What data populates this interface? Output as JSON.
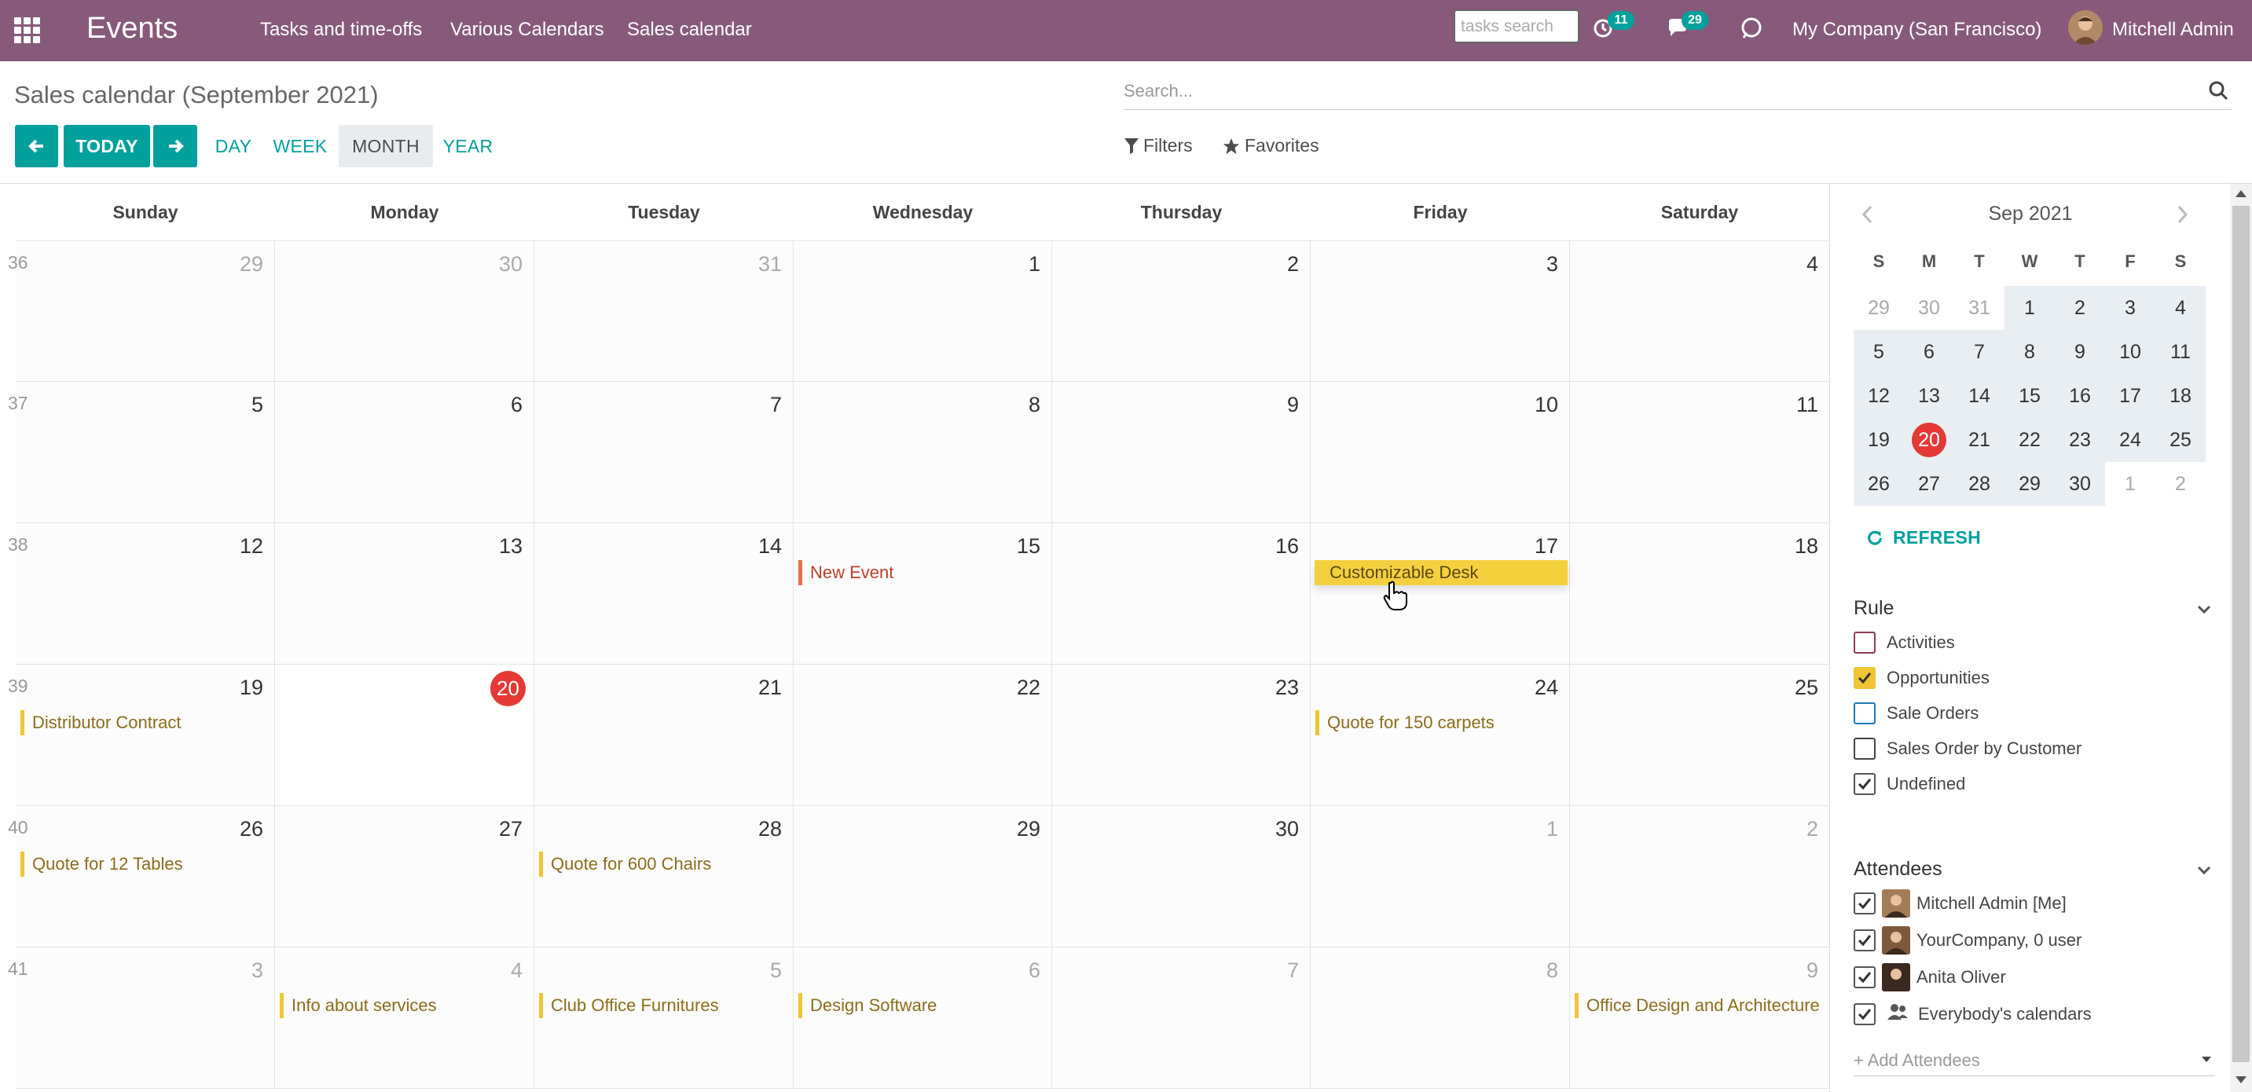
{
  "navbar": {
    "app_title": "Events",
    "menus": [
      "Tasks and time-offs",
      "Various Calendars",
      "Sales calendar"
    ],
    "tasks_search_placeholder": "tasks search",
    "activity_badge": "11",
    "messages_badge": "29",
    "company": "My Company (San Francisco)",
    "user": "Mitchell Admin"
  },
  "control_panel": {
    "breadcrumb": "Sales calendar (September 2021)",
    "search_placeholder": "Search...",
    "today_label": "TODAY",
    "scales": [
      "DAY",
      "WEEK",
      "MONTH",
      "YEAR"
    ],
    "active_scale": "MONTH",
    "filters_label": "Filters",
    "favorites_label": "Favorites"
  },
  "calendar": {
    "day_names": [
      "Sunday",
      "Monday",
      "Tuesday",
      "Wednesday",
      "Thursday",
      "Friday",
      "Saturday"
    ],
    "weeks": [
      {
        "num": "36",
        "days": [
          "29",
          "30",
          "31",
          "1",
          "2",
          "3",
          "4"
        ],
        "other": [
          true,
          true,
          true,
          false,
          false,
          false,
          false
        ]
      },
      {
        "num": "37",
        "days": [
          "5",
          "6",
          "7",
          "8",
          "9",
          "10",
          "11"
        ],
        "other": [
          false,
          false,
          false,
          false,
          false,
          false,
          false
        ]
      },
      {
        "num": "38",
        "days": [
          "12",
          "13",
          "14",
          "15",
          "16",
          "17",
          "18"
        ],
        "other": [
          false,
          false,
          false,
          false,
          false,
          false,
          false
        ]
      },
      {
        "num": "39",
        "days": [
          "19",
          "20",
          "21",
          "22",
          "23",
          "24",
          "25"
        ],
        "other": [
          false,
          false,
          false,
          false,
          false,
          false,
          false
        ]
      },
      {
        "num": "40",
        "days": [
          "26",
          "27",
          "28",
          "29",
          "30",
          "1",
          "2"
        ],
        "other": [
          false,
          false,
          false,
          false,
          false,
          true,
          true
        ]
      },
      {
        "num": "41",
        "days": [
          "3",
          "4",
          "5",
          "6",
          "7",
          "8",
          "9"
        ],
        "other": [
          true,
          true,
          true,
          true,
          true,
          true,
          true
        ]
      }
    ],
    "today": "20",
    "events": [
      {
        "title": "New Event",
        "week": 2,
        "day": 3,
        "style": "red"
      },
      {
        "title": "Customizable Desk",
        "week": 2,
        "day": 5,
        "style": "highlight"
      },
      {
        "title": "Distributor Contract",
        "week": 3,
        "day": 0,
        "style": "yellow"
      },
      {
        "title": "Quote for 150 carpets",
        "week": 3,
        "day": 5,
        "style": "yellow"
      },
      {
        "title": "Quote for 12 Tables",
        "week": 4,
        "day": 0,
        "style": "yellow"
      },
      {
        "title": "Quote for 600 Chairs",
        "week": 4,
        "day": 2,
        "style": "yellow"
      },
      {
        "title": "Info about services",
        "week": 5,
        "day": 1,
        "style": "yellow"
      },
      {
        "title": "Club Office Furnitures",
        "week": 5,
        "day": 2,
        "style": "yellow"
      },
      {
        "title": "Design Software",
        "week": 5,
        "day": 3,
        "style": "yellow"
      },
      {
        "title": "Office Design and Architecture",
        "week": 5,
        "day": 6,
        "style": "yellow"
      }
    ]
  },
  "sidebar": {
    "mini_title": "Sep 2021",
    "mini_heads": [
      "S",
      "M",
      "T",
      "W",
      "T",
      "F",
      "S"
    ],
    "mini_weeks": [
      [
        "29",
        "30",
        "31",
        "1",
        "2",
        "3",
        "4"
      ],
      [
        "5",
        "6",
        "7",
        "8",
        "9",
        "10",
        "11"
      ],
      [
        "12",
        "13",
        "14",
        "15",
        "16",
        "17",
        "18"
      ],
      [
        "19",
        "20",
        "21",
        "22",
        "23",
        "24",
        "25"
      ],
      [
        "26",
        "27",
        "28",
        "29",
        "30",
        "1",
        "2"
      ]
    ],
    "refresh_label": "REFRESH",
    "rule_title": "Rule",
    "rules": [
      {
        "label": "Activities",
        "checked": false,
        "color": "#8c3b5a"
      },
      {
        "label": "Opportunities",
        "checked": true,
        "color": "#f0c533"
      },
      {
        "label": "Sale Orders",
        "checked": false,
        "color": "#1e7ab5"
      },
      {
        "label": "Sales Order by Customer",
        "checked": false,
        "color": "#444444"
      },
      {
        "label": "Undefined",
        "checked": true,
        "color": "#555555"
      }
    ],
    "attendees_title": "Attendees",
    "attendees": [
      {
        "label": "Mitchell Admin [Me]",
        "icon": "avatar"
      },
      {
        "label": "YourCompany, 0 user",
        "icon": "avatar"
      },
      {
        "label": "Anita Oliver",
        "icon": "avatar"
      },
      {
        "label": "Everybody's calendars",
        "icon": "users-icon"
      }
    ],
    "add_attendees": "+ Add Attendees"
  }
}
